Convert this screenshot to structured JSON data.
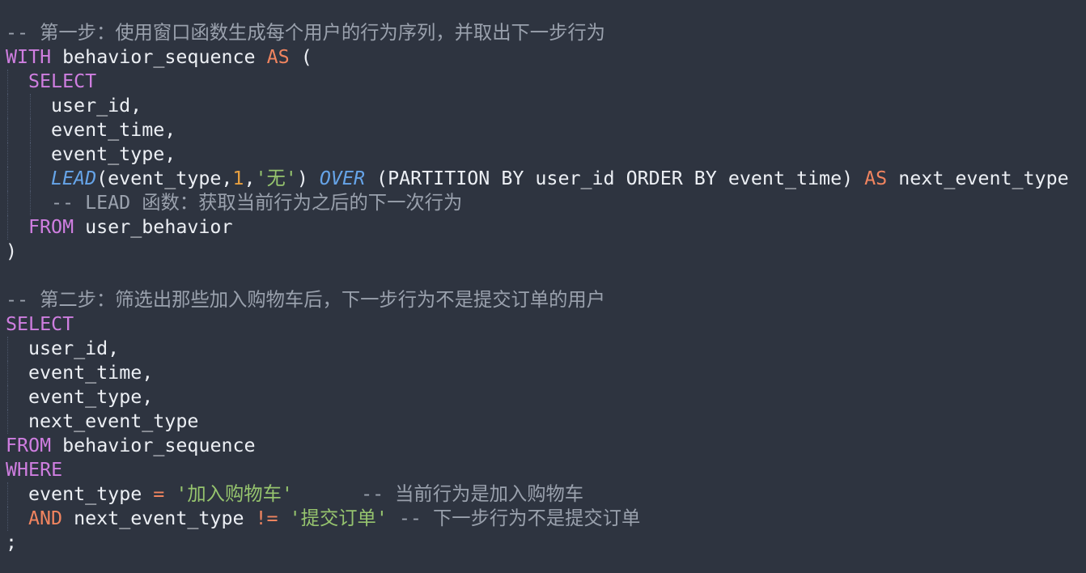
{
  "editor": {
    "language": "SQL",
    "colors": {
      "background": "#2e3440",
      "text": "#eceff4",
      "comment": "#9aa1ad",
      "keyword_purple": "#cf7ee0",
      "keyword_orange": "#f0845f",
      "function": "#66a4e8",
      "string": "#96c46e",
      "number": "#e8a040"
    },
    "lines": [
      {
        "indent": 0,
        "tokens": [
          {
            "t": "-- 第一步：使用窗口函数生成每个用户的行为序列，并取出下一步行为",
            "k": "cmt"
          }
        ]
      },
      {
        "indent": 0,
        "tokens": [
          {
            "t": "WITH",
            "k": "kw-purple"
          },
          {
            "t": " behavior_sequence ",
            "k": "id"
          },
          {
            "t": "AS",
            "k": "kw-orange"
          },
          {
            "t": " (",
            "k": "id"
          }
        ]
      },
      {
        "indent": 1,
        "tokens": [
          {
            "t": "SELECT",
            "k": "kw-purple"
          }
        ]
      },
      {
        "indent": 2,
        "tokens": [
          {
            "t": "user_id,",
            "k": "id"
          }
        ]
      },
      {
        "indent": 2,
        "tokens": [
          {
            "t": "event_time,",
            "k": "id"
          }
        ]
      },
      {
        "indent": 2,
        "tokens": [
          {
            "t": "event_type,",
            "k": "id"
          }
        ]
      },
      {
        "indent": 2,
        "tokens": [
          {
            "t": "LEAD",
            "k": "fn"
          },
          {
            "t": "(event_type,",
            "k": "id"
          },
          {
            "t": "1",
            "k": "num"
          },
          {
            "t": ",",
            "k": "id"
          },
          {
            "t": "'无'",
            "k": "str"
          },
          {
            "t": ") ",
            "k": "id"
          },
          {
            "t": "OVER",
            "k": "fn"
          },
          {
            "t": " (PARTITION BY user_id ORDER BY event_time) ",
            "k": "id"
          },
          {
            "t": "AS",
            "k": "kw-orange"
          },
          {
            "t": " next_event_type",
            "k": "id"
          }
        ]
      },
      {
        "indent": 2,
        "tokens": [
          {
            "t": "-- LEAD 函数：获取当前行为之后的下一次行为",
            "k": "cmt"
          }
        ]
      },
      {
        "indent": 1,
        "tokens": [
          {
            "t": "FROM",
            "k": "kw-purple"
          },
          {
            "t": " user_behavior",
            "k": "id"
          }
        ]
      },
      {
        "indent": 0,
        "tokens": [
          {
            "t": ")",
            "k": "id"
          }
        ]
      },
      {
        "indent": 0,
        "tokens": []
      },
      {
        "indent": 0,
        "tokens": [
          {
            "t": "-- 第二步：筛选出那些加入购物车后，下一步行为不是提交订单的用户",
            "k": "cmt"
          }
        ]
      },
      {
        "indent": 0,
        "tokens": [
          {
            "t": "SELECT",
            "k": "kw-purple"
          }
        ]
      },
      {
        "indent": 1,
        "tokens": [
          {
            "t": "user_id,",
            "k": "id"
          }
        ]
      },
      {
        "indent": 1,
        "tokens": [
          {
            "t": "event_time,",
            "k": "id"
          }
        ]
      },
      {
        "indent": 1,
        "tokens": [
          {
            "t": "event_type,",
            "k": "id"
          }
        ]
      },
      {
        "indent": 1,
        "tokens": [
          {
            "t": "next_event_type",
            "k": "id"
          }
        ]
      },
      {
        "indent": 0,
        "tokens": [
          {
            "t": "FROM",
            "k": "kw-purple"
          },
          {
            "t": " behavior_sequence",
            "k": "id"
          }
        ]
      },
      {
        "indent": 0,
        "tokens": [
          {
            "t": "WHERE",
            "k": "kw-purple"
          }
        ]
      },
      {
        "indent": 1,
        "tokens": [
          {
            "t": "event_type ",
            "k": "id"
          },
          {
            "t": "=",
            "k": "kw-orange"
          },
          {
            "t": " ",
            "k": "id"
          },
          {
            "t": "'加入购物车'",
            "k": "str"
          },
          {
            "t": "      ",
            "k": "id"
          },
          {
            "t": "-- 当前行为是加入购物车",
            "k": "cmt"
          }
        ]
      },
      {
        "indent": 1,
        "tokens": [
          {
            "t": "AND",
            "k": "kw-orange"
          },
          {
            "t": " next_event_type ",
            "k": "id"
          },
          {
            "t": "!=",
            "k": "kw-orange"
          },
          {
            "t": " ",
            "k": "id"
          },
          {
            "t": "'提交订单'",
            "k": "str"
          },
          {
            "t": " ",
            "k": "id"
          },
          {
            "t": "-- 下一步行为不是提交订单",
            "k": "cmt"
          }
        ]
      },
      {
        "indent": 0,
        "tokens": [
          {
            "t": ";",
            "k": "id"
          }
        ]
      }
    ]
  }
}
